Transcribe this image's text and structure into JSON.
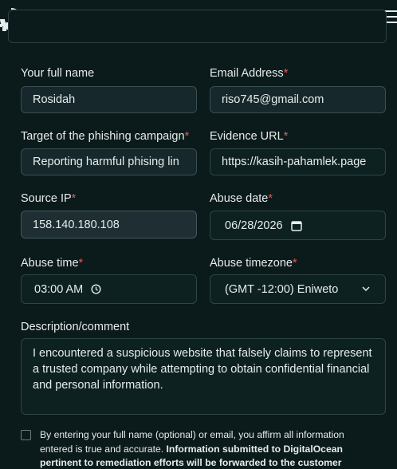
{
  "brand": {
    "logo_icon": "digitalocean-logo-icon",
    "menu_icon": "hamburger-menu-icon"
  },
  "form": {
    "full_name": {
      "label": "Your full name",
      "value": "Rosidah"
    },
    "email": {
      "label": "Email Address",
      "required_mark": "*",
      "value": "riso745@gmail.com"
    },
    "target": {
      "label": "Target of the phishing campaign",
      "required_mark": "*",
      "value": "Reporting harmful phising lin"
    },
    "evidence_url": {
      "label": "Evidence URL",
      "required_mark": "*",
      "value": "https://kasih-pahamlek.page"
    },
    "source_ip": {
      "label": "Source IP",
      "required_mark": "*",
      "value": "158.140.180.108"
    },
    "abuse_date": {
      "label": "Abuse date",
      "required_mark": "*",
      "value": "06/28/2026"
    },
    "abuse_time": {
      "label": "Abuse time",
      "required_mark": "*",
      "value": "03:00 AM"
    },
    "abuse_timezone": {
      "label": "Abuse timezone",
      "required_mark": "*",
      "value": "(GMT -12:00) Eniweto"
    },
    "description": {
      "label": "Description/comment",
      "value": "I encountered a suspicious website that falsely claims to represent a trusted company while attempting to obtain confidential financial and personal information."
    },
    "consent": {
      "text_regular": "By entering your full name (optional) or email, you affirm all information entered is true and accurate.",
      "text_bold": "Information submitted to DigitalOcean pertinent to remediation efforts will be forwarded to the customer"
    }
  },
  "colors": {
    "background": "#0b1a1a",
    "required": "#e05a5a",
    "text": "#e6ecec"
  }
}
